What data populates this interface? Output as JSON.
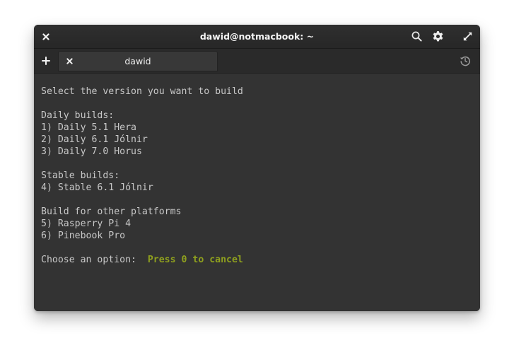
{
  "window": {
    "title": "dawid@notmacbook: ~"
  },
  "titlebar_icons": {
    "close": "close-icon",
    "search": "search-icon",
    "settings": "gear-icon",
    "maximize": "maximize-icon"
  },
  "tabs": {
    "new_tab_icon": "plus-icon",
    "items": [
      {
        "label": "dawid",
        "close_icon": "close-icon"
      }
    ],
    "history_icon": "history-icon"
  },
  "terminal": {
    "lines": [
      "Select the version you want to build",
      "",
      "Daily builds:",
      "1) Daily 5.1 Hera",
      "2) Daily 6.1 Jólnir",
      "3) Daily 7.0 Horus",
      "",
      "Stable builds:",
      "4) Stable 6.1 Jólnir",
      "",
      "Build for other platforms",
      "5) Rasperry Pi 4",
      "6) Pinebook Pro",
      ""
    ],
    "prompt_label": "Choose an option:  ",
    "prompt_hint": "Press 0 to cancel"
  },
  "colors": {
    "background": "#333333",
    "text": "#c8c8c8",
    "hint": "#8fa01e"
  }
}
